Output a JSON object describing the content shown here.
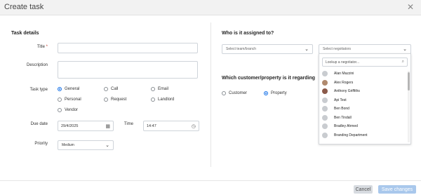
{
  "dialog": {
    "title": "Create task",
    "close_icon": "close-icon"
  },
  "task_details": {
    "heading": "Task details",
    "title_label": "Title",
    "title_required_mark": "*",
    "description_label": "Description",
    "task_type_label": "Task type",
    "task_types": [
      {
        "label": "General",
        "selected": true
      },
      {
        "label": "Call",
        "selected": false
      },
      {
        "label": "Email",
        "selected": false
      },
      {
        "label": "Personal",
        "selected": false
      },
      {
        "label": "Request",
        "selected": false
      },
      {
        "label": "Landlord",
        "selected": false
      },
      {
        "label": "Vendor",
        "selected": false
      }
    ],
    "due_date_label": "Due date",
    "due_date_value": "29/4/2025",
    "time_label": "Time",
    "time_value": "14:47",
    "priority_label": "Priority",
    "priority_value": "Medium"
  },
  "assignment": {
    "heading": "Who is it assigned to?",
    "team_placeholder": "Select team/branch",
    "negotiator_placeholder": "Select negotiators",
    "search_placeholder": "Lookup a negotiator...",
    "negotiators": [
      "Alan Mazzini",
      "Alex Rogers",
      "Anthony Griffiths",
      "Api Test",
      "Ben Bond",
      "Ben Tindall",
      "Bradley Ahmed",
      "Branding Department"
    ]
  },
  "customer_property": {
    "heading": "Which customer/property is it regarding",
    "options": [
      {
        "label": "Customer",
        "selected": false
      },
      {
        "label": "Property",
        "selected": true
      }
    ]
  },
  "footer": {
    "cancel_label": "Cancel",
    "save_label": "Save changes"
  },
  "colors": {
    "accent": "#1a73e8",
    "save_button": "#a9c8ec",
    "cancel_button": "#d7dbe0"
  }
}
